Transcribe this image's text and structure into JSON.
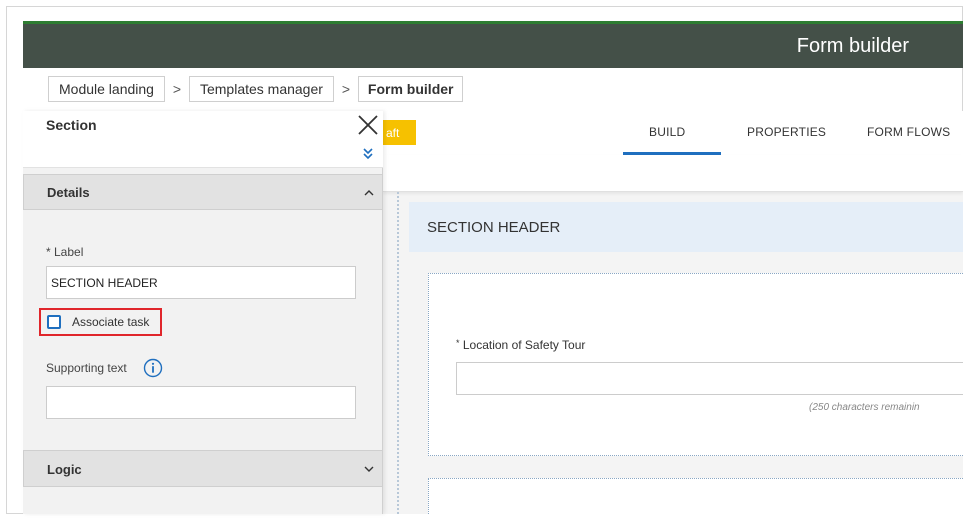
{
  "header": {
    "title": "Form builder"
  },
  "breadcrumb": {
    "items": [
      "Module landing",
      "Templates manager",
      "Form builder"
    ],
    "separator": ">"
  },
  "side_panel": {
    "title": "Section",
    "details": {
      "title": "Details",
      "label_caption": "* Label",
      "label_value": "SECTION HEADER",
      "associate_task_label": "Associate task",
      "associate_task_checked": false,
      "supporting_text_caption": "Supporting text"
    },
    "logic": {
      "title": "Logic"
    }
  },
  "main": {
    "draft_badge": "aft",
    "tabs": [
      {
        "label": "BUILD",
        "active": true
      },
      {
        "label": "PROPERTIES",
        "active": false
      },
      {
        "label": "FORM FLOWS",
        "active": false
      }
    ],
    "section_header": "SECTION HEADER",
    "field": {
      "required_mark": "*",
      "label": "Location of Safety Tour",
      "remaining": "(250 characters remainin"
    }
  },
  "colors": {
    "header_bg": "#445048",
    "accent_blue": "#1f6fbf",
    "draft_yellow": "#f6c100",
    "highlight_red": "#e0262b",
    "section_header_bg": "#e5eef8"
  },
  "icons": {
    "close": "close-icon",
    "expand": "double-chevron-down-icon",
    "details_toggle": "chevron-up-icon",
    "logic_toggle": "chevron-down-icon",
    "info": "info-icon"
  }
}
